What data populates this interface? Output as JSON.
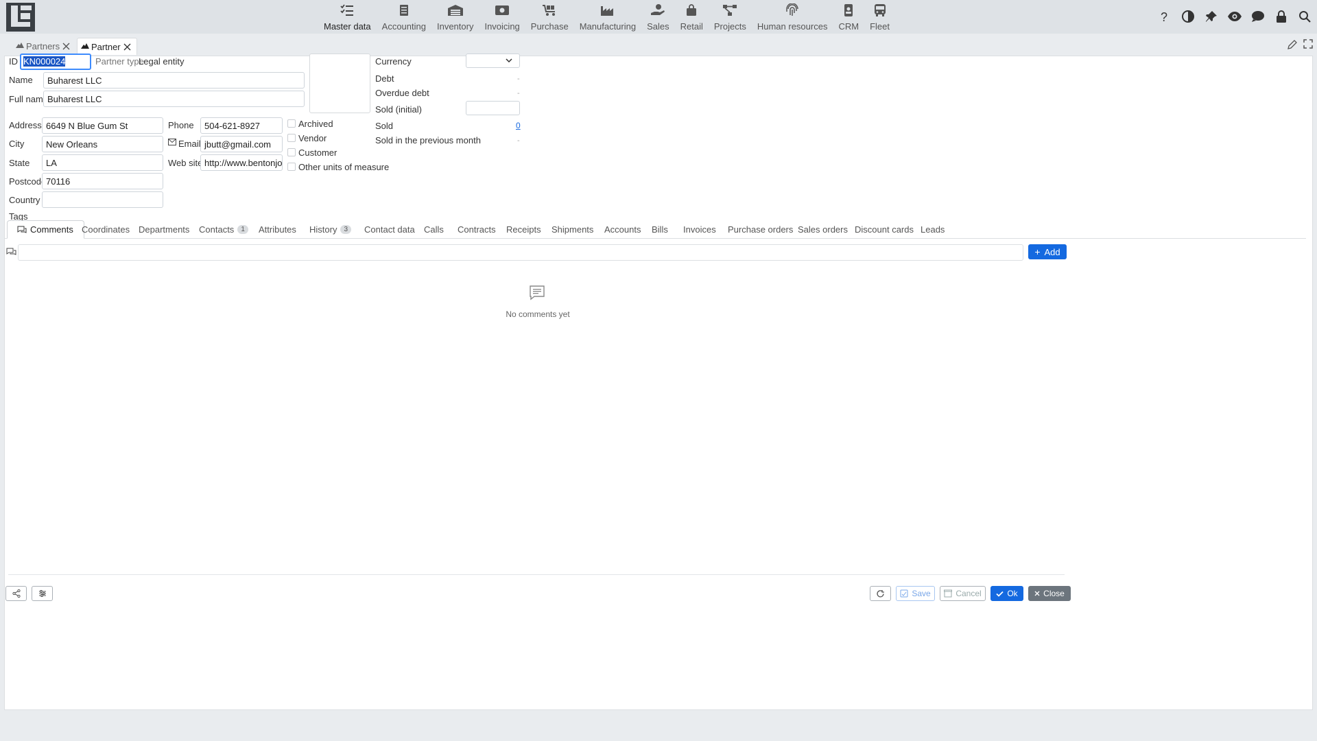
{
  "nav": {
    "modules": [
      {
        "label": "Master data",
        "icon": "checklist-icon"
      },
      {
        "label": "Accounting",
        "icon": "ledger-icon"
      },
      {
        "label": "Inventory",
        "icon": "warehouse-icon"
      },
      {
        "label": "Invoicing",
        "icon": "cash-icon"
      },
      {
        "label": "Purchase",
        "icon": "cart-icon"
      },
      {
        "label": "Manufacturing",
        "icon": "factory-icon"
      },
      {
        "label": "Sales",
        "icon": "hand-money-icon"
      },
      {
        "label": "Retail",
        "icon": "shopping-bag-icon"
      },
      {
        "label": "Projects",
        "icon": "project-diagram-icon"
      },
      {
        "label": "Human resources",
        "icon": "fingerprint-icon"
      },
      {
        "label": "CRM",
        "icon": "id-badge-icon"
      },
      {
        "label": "Fleet",
        "icon": "bus-icon"
      }
    ],
    "tools": [
      "help-icon",
      "contrast-icon",
      "pin-icon",
      "eye-icon",
      "chat-icon",
      "lock-icon",
      "search-icon"
    ]
  },
  "tabs": [
    {
      "label": "Partners"
    },
    {
      "label": "Partner"
    }
  ],
  "form": {
    "id_label": "ID",
    "id_value": "KN000024",
    "partner_type_label": "Partner type",
    "partner_type_value": "Legal entity",
    "name_label": "Name",
    "name_value": "Buharest LLC",
    "full_name_label": "Full name",
    "full_name_value": "Buharest LLC",
    "address_label": "Address",
    "address_value": "6649 N Blue Gum St",
    "city_label": "City",
    "city_value": "New Orleans",
    "state_label": "State",
    "state_value": "LA",
    "postcode_label": "Postcode",
    "postcode_value": "70116",
    "country_label": "Country",
    "country_value": "",
    "phone_label": "Phone",
    "phone_value": "504-621-8927",
    "email_label": "Email",
    "email_value": "jbutt@gmail.com",
    "website_label": "Web site",
    "website_value": "http://www.bentonjohnb",
    "checkboxes": [
      "Archived",
      "Vendor",
      "Customer",
      "Other units of measure"
    ],
    "currency_label": "Currency",
    "currency_value": "",
    "debt_label": "Debt",
    "debt_value": "-",
    "overdue_label": "Overdue debt",
    "overdue_value": "-",
    "sold_initial_label": "Sold (initial)",
    "sold_initial_value": "",
    "sold_label": "Sold",
    "sold_value": "0",
    "sold_prev_label": "Sold in the previous month",
    "sold_prev_value": "-",
    "tags_label": "Tags"
  },
  "detail_tabs": [
    {
      "label": "Comments",
      "badge": ""
    },
    {
      "label": "Coordinates",
      "badge": ""
    },
    {
      "label": "Departments",
      "badge": ""
    },
    {
      "label": "Contacts",
      "badge": "1"
    },
    {
      "label": "Attributes",
      "badge": ""
    },
    {
      "label": "History",
      "badge": "3"
    },
    {
      "label": "Contact data",
      "badge": ""
    },
    {
      "label": "Calls",
      "badge": ""
    },
    {
      "label": "Contracts",
      "badge": ""
    },
    {
      "label": "Receipts",
      "badge": ""
    },
    {
      "label": "Shipments",
      "badge": ""
    },
    {
      "label": "Accounts",
      "badge": ""
    },
    {
      "label": "Bills",
      "badge": ""
    },
    {
      "label": "Invoices",
      "badge": ""
    },
    {
      "label": "Purchase orders",
      "badge": ""
    },
    {
      "label": "Sales orders",
      "badge": ""
    },
    {
      "label": "Discount cards",
      "badge": ""
    },
    {
      "label": "Leads",
      "badge": ""
    }
  ],
  "comments": {
    "add_label": "Add",
    "empty_text": "No comments yet"
  },
  "footer": {
    "save_label": "Save",
    "cancel_label": "Cancel",
    "ok_label": "Ok",
    "close_label": "Close"
  },
  "colors": {
    "accent": "#1469e0",
    "topbar": "#dee2e6",
    "close_button": "#6c757d"
  }
}
